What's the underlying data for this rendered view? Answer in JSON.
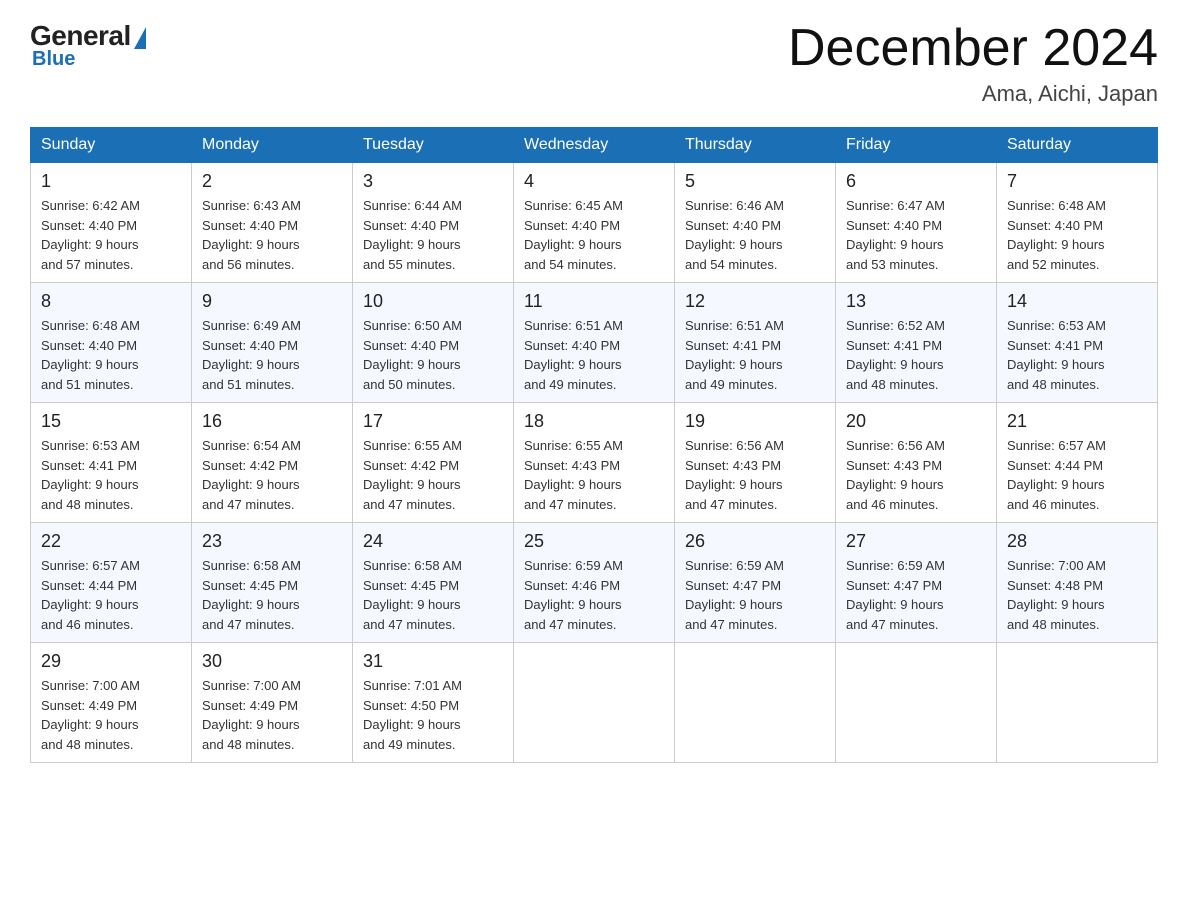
{
  "header": {
    "logo_general": "General",
    "logo_blue": "Blue",
    "month_title": "December 2024",
    "location": "Ama, Aichi, Japan"
  },
  "days_of_week": [
    "Sunday",
    "Monday",
    "Tuesday",
    "Wednesday",
    "Thursday",
    "Friday",
    "Saturday"
  ],
  "weeks": [
    [
      {
        "day": "1",
        "sunrise": "Sunrise: 6:42 AM",
        "sunset": "Sunset: 4:40 PM",
        "daylight": "Daylight: 9 hours",
        "daylight2": "and 57 minutes."
      },
      {
        "day": "2",
        "sunrise": "Sunrise: 6:43 AM",
        "sunset": "Sunset: 4:40 PM",
        "daylight": "Daylight: 9 hours",
        "daylight2": "and 56 minutes."
      },
      {
        "day": "3",
        "sunrise": "Sunrise: 6:44 AM",
        "sunset": "Sunset: 4:40 PM",
        "daylight": "Daylight: 9 hours",
        "daylight2": "and 55 minutes."
      },
      {
        "day": "4",
        "sunrise": "Sunrise: 6:45 AM",
        "sunset": "Sunset: 4:40 PM",
        "daylight": "Daylight: 9 hours",
        "daylight2": "and 54 minutes."
      },
      {
        "day": "5",
        "sunrise": "Sunrise: 6:46 AM",
        "sunset": "Sunset: 4:40 PM",
        "daylight": "Daylight: 9 hours",
        "daylight2": "and 54 minutes."
      },
      {
        "day": "6",
        "sunrise": "Sunrise: 6:47 AM",
        "sunset": "Sunset: 4:40 PM",
        "daylight": "Daylight: 9 hours",
        "daylight2": "and 53 minutes."
      },
      {
        "day": "7",
        "sunrise": "Sunrise: 6:48 AM",
        "sunset": "Sunset: 4:40 PM",
        "daylight": "Daylight: 9 hours",
        "daylight2": "and 52 minutes."
      }
    ],
    [
      {
        "day": "8",
        "sunrise": "Sunrise: 6:48 AM",
        "sunset": "Sunset: 4:40 PM",
        "daylight": "Daylight: 9 hours",
        "daylight2": "and 51 minutes."
      },
      {
        "day": "9",
        "sunrise": "Sunrise: 6:49 AM",
        "sunset": "Sunset: 4:40 PM",
        "daylight": "Daylight: 9 hours",
        "daylight2": "and 51 minutes."
      },
      {
        "day": "10",
        "sunrise": "Sunrise: 6:50 AM",
        "sunset": "Sunset: 4:40 PM",
        "daylight": "Daylight: 9 hours",
        "daylight2": "and 50 minutes."
      },
      {
        "day": "11",
        "sunrise": "Sunrise: 6:51 AM",
        "sunset": "Sunset: 4:40 PM",
        "daylight": "Daylight: 9 hours",
        "daylight2": "and 49 minutes."
      },
      {
        "day": "12",
        "sunrise": "Sunrise: 6:51 AM",
        "sunset": "Sunset: 4:41 PM",
        "daylight": "Daylight: 9 hours",
        "daylight2": "and 49 minutes."
      },
      {
        "day": "13",
        "sunrise": "Sunrise: 6:52 AM",
        "sunset": "Sunset: 4:41 PM",
        "daylight": "Daylight: 9 hours",
        "daylight2": "and 48 minutes."
      },
      {
        "day": "14",
        "sunrise": "Sunrise: 6:53 AM",
        "sunset": "Sunset: 4:41 PM",
        "daylight": "Daylight: 9 hours",
        "daylight2": "and 48 minutes."
      }
    ],
    [
      {
        "day": "15",
        "sunrise": "Sunrise: 6:53 AM",
        "sunset": "Sunset: 4:41 PM",
        "daylight": "Daylight: 9 hours",
        "daylight2": "and 48 minutes."
      },
      {
        "day": "16",
        "sunrise": "Sunrise: 6:54 AM",
        "sunset": "Sunset: 4:42 PM",
        "daylight": "Daylight: 9 hours",
        "daylight2": "and 47 minutes."
      },
      {
        "day": "17",
        "sunrise": "Sunrise: 6:55 AM",
        "sunset": "Sunset: 4:42 PM",
        "daylight": "Daylight: 9 hours",
        "daylight2": "and 47 minutes."
      },
      {
        "day": "18",
        "sunrise": "Sunrise: 6:55 AM",
        "sunset": "Sunset: 4:43 PM",
        "daylight": "Daylight: 9 hours",
        "daylight2": "and 47 minutes."
      },
      {
        "day": "19",
        "sunrise": "Sunrise: 6:56 AM",
        "sunset": "Sunset: 4:43 PM",
        "daylight": "Daylight: 9 hours",
        "daylight2": "and 47 minutes."
      },
      {
        "day": "20",
        "sunrise": "Sunrise: 6:56 AM",
        "sunset": "Sunset: 4:43 PM",
        "daylight": "Daylight: 9 hours",
        "daylight2": "and 46 minutes."
      },
      {
        "day": "21",
        "sunrise": "Sunrise: 6:57 AM",
        "sunset": "Sunset: 4:44 PM",
        "daylight": "Daylight: 9 hours",
        "daylight2": "and 46 minutes."
      }
    ],
    [
      {
        "day": "22",
        "sunrise": "Sunrise: 6:57 AM",
        "sunset": "Sunset: 4:44 PM",
        "daylight": "Daylight: 9 hours",
        "daylight2": "and 46 minutes."
      },
      {
        "day": "23",
        "sunrise": "Sunrise: 6:58 AM",
        "sunset": "Sunset: 4:45 PM",
        "daylight": "Daylight: 9 hours",
        "daylight2": "and 47 minutes."
      },
      {
        "day": "24",
        "sunrise": "Sunrise: 6:58 AM",
        "sunset": "Sunset: 4:45 PM",
        "daylight": "Daylight: 9 hours",
        "daylight2": "and 47 minutes."
      },
      {
        "day": "25",
        "sunrise": "Sunrise: 6:59 AM",
        "sunset": "Sunset: 4:46 PM",
        "daylight": "Daylight: 9 hours",
        "daylight2": "and 47 minutes."
      },
      {
        "day": "26",
        "sunrise": "Sunrise: 6:59 AM",
        "sunset": "Sunset: 4:47 PM",
        "daylight": "Daylight: 9 hours",
        "daylight2": "and 47 minutes."
      },
      {
        "day": "27",
        "sunrise": "Sunrise: 6:59 AM",
        "sunset": "Sunset: 4:47 PM",
        "daylight": "Daylight: 9 hours",
        "daylight2": "and 47 minutes."
      },
      {
        "day": "28",
        "sunrise": "Sunrise: 7:00 AM",
        "sunset": "Sunset: 4:48 PM",
        "daylight": "Daylight: 9 hours",
        "daylight2": "and 48 minutes."
      }
    ],
    [
      {
        "day": "29",
        "sunrise": "Sunrise: 7:00 AM",
        "sunset": "Sunset: 4:49 PM",
        "daylight": "Daylight: 9 hours",
        "daylight2": "and 48 minutes."
      },
      {
        "day": "30",
        "sunrise": "Sunrise: 7:00 AM",
        "sunset": "Sunset: 4:49 PM",
        "daylight": "Daylight: 9 hours",
        "daylight2": "and 48 minutes."
      },
      {
        "day": "31",
        "sunrise": "Sunrise: 7:01 AM",
        "sunset": "Sunset: 4:50 PM",
        "daylight": "Daylight: 9 hours",
        "daylight2": "and 49 minutes."
      },
      null,
      null,
      null,
      null
    ]
  ]
}
